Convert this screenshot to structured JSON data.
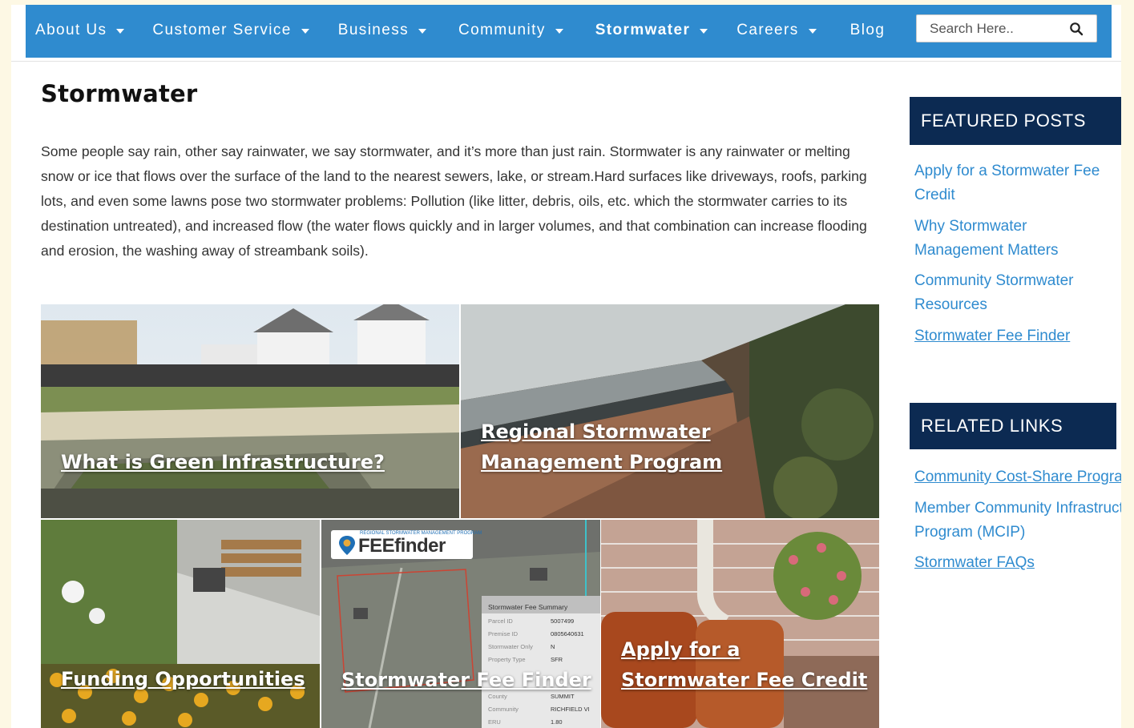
{
  "nav": {
    "items": [
      {
        "label": "About Us",
        "has_caret": true
      },
      {
        "label": "Customer Service",
        "has_caret": true
      },
      {
        "label": "Business",
        "has_caret": true
      },
      {
        "label": "Community",
        "has_caret": true
      },
      {
        "label": "Stormwater",
        "has_caret": true,
        "active": true
      },
      {
        "label": "Careers",
        "has_caret": true
      },
      {
        "label": "Blog",
        "has_caret": false
      }
    ],
    "search_placeholder": "Search Here..",
    "search_icon": "search-icon"
  },
  "page": {
    "title": "Stormwater",
    "intro": "Some people say rain, other say rainwater, we say stormwater, and it’s more than just rain. Stormwater is any rainwater or melting snow or ice that flows over the surface of the land to the nearest sewers, lake, or stream.Hard surfaces like driveways, roofs, parking lots, and even some lawns pose two stormwater problems: Pollution (like litter, debris, oils, etc. which the stormwater carries to its destination untreated), and increased flow (the water flows quickly and in larger volumes, and that combination can increase flooding and erosion, the washing away of streambank soils)."
  },
  "tiles": {
    "green": "What is Green Infrastructure?",
    "regional": "Regional Stormwater Management Program",
    "funding": "Funding Opportunities",
    "finder": "Stormwater Fee Finder",
    "apply": "Apply for a Stormwater Fee Credit",
    "finder_logo_small": "REGIONAL STORMWATER MANAGEMENT PROGRAM",
    "finder_logo": "FEEfinder",
    "fee_summary": {
      "title": "Stormwater Fee Summary",
      "rows": [
        {
          "label": "Parcel ID",
          "value": "5007499"
        },
        {
          "label": "Premise ID",
          "value": "0805640631"
        },
        {
          "label": "Stormwater Only",
          "value": "N"
        },
        {
          "label": "Property Type",
          "value": "SFR"
        },
        {
          "label": "County",
          "value": "SUMMIT"
        },
        {
          "label": "Community",
          "value": "RICHFIELD VI"
        },
        {
          "label": "ERU",
          "value": "1.80"
        }
      ]
    }
  },
  "sidebar": {
    "featured_title": "FEATURED POSTS",
    "featured_links": [
      "Apply for a Stormwater Fee Credit",
      "Why Stormwater Management Matters",
      "Community Stormwater Resources",
      "Stormwater Fee Finder"
    ],
    "related_title": "RELATED LINKS",
    "related_links": [
      "Community Cost-Share Program",
      "Member Community Infrastructure Program (MCIP)",
      "Stormwater FAQs"
    ]
  },
  "colors": {
    "nav_blue": "#2f8bcf",
    "widget_navy": "#0c2a52",
    "link_blue": "#2f8bcf"
  }
}
